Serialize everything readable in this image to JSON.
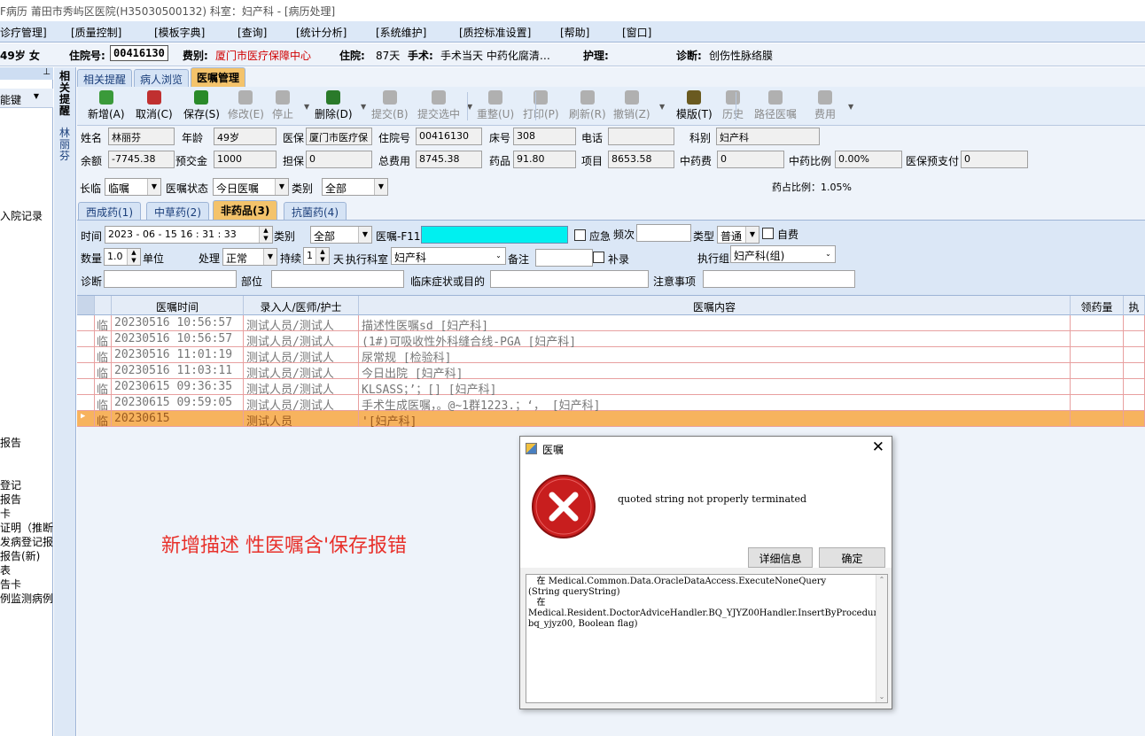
{
  "window": {
    "title": "F病历  莆田市秀屿区医院(H35030500132)  科室：妇产科 - [病历处理]"
  },
  "menu": [
    "诊疗管理]",
    "[质量控制]",
    "[模板字典]",
    "[查询]",
    "[统计分析]",
    "[系统维护]",
    "[质控标准设置]",
    "[帮助]",
    "[窗口]"
  ],
  "patient_bar": {
    "age_sex": "49岁 女",
    "inpatient_no_label": "住院号:",
    "inpatient_no": "00416130",
    "fee_type_label": "费别:",
    "fee_type": "厦门市医疗保障中心",
    "stay_label": "住院:",
    "stay": "87天",
    "surgery_label": "手术:",
    "surgery": "手术当天  中药化腐清…",
    "nursing_label": "护理:",
    "nursing": "",
    "diagnosis_label": "诊断:",
    "diagnosis": "创伤性脉络膜"
  },
  "left_panel": {
    "func_key": "能键",
    "links": [
      "入院记录",
      "报告",
      "登记",
      "报告",
      "卡",
      "证明（推断",
      "发病登记报",
      "报告(新)",
      "表",
      "告卡",
      "例监测病例"
    ]
  },
  "vertical_tabs": {
    "related": "相关提醒",
    "patient": "林丽芬"
  },
  "top_tabs": {
    "items": [
      "相关提醒",
      "病人浏览",
      "医嘱管理"
    ],
    "active": 2
  },
  "toolbar": [
    {
      "label": "新增(A)",
      "icon": "add-icon",
      "color": "#3a9a3a",
      "enabled": true
    },
    {
      "label": "取消(C)",
      "icon": "undo-icon",
      "color": "#c03030",
      "enabled": true
    },
    {
      "label": "保存(S)",
      "icon": "save-icon",
      "color": "#2a8a2a",
      "enabled": true
    },
    {
      "label": "修改(E)",
      "icon": "edit-icon",
      "color": "#b0b0b0",
      "enabled": false
    },
    {
      "label": "停止",
      "icon": "stop-icon",
      "color": "#b0b0b0",
      "enabled": false
    },
    {
      "label": "删除(D)",
      "icon": "delete-icon",
      "color": "#2a7a2a",
      "enabled": true
    },
    {
      "label": "提交(B)",
      "icon": "submit-icon",
      "color": "#b0b0b0",
      "enabled": false
    },
    {
      "label": "提交选中",
      "icon": "submit-selected-icon",
      "color": "#b0b0b0",
      "enabled": false
    },
    {
      "label": "重整(U)",
      "icon": "rearrange-icon",
      "color": "#b0b0b0",
      "enabled": false
    },
    {
      "label": "打印(P)",
      "icon": "print-icon",
      "color": "#b0b0b0",
      "enabled": false
    },
    {
      "label": "刷新(R)",
      "icon": "refresh-icon",
      "color": "#b0b0b0",
      "enabled": false
    },
    {
      "label": "撤销(Z)",
      "icon": "revoke-icon",
      "color": "#b0b0b0",
      "enabled": false
    },
    {
      "label": "模版(T)",
      "icon": "template-icon",
      "color": "#6a5a20",
      "enabled": true
    },
    {
      "label": "历史",
      "icon": "history-icon",
      "color": "#b0b0b0",
      "enabled": false
    },
    {
      "label": "路径医嘱",
      "icon": "pathway-icon",
      "color": "#b0b0b0",
      "enabled": false
    },
    {
      "label": "费用",
      "icon": "fee-icon",
      "color": "#b0b0b0",
      "enabled": false
    }
  ],
  "patient_info": {
    "name_label": "姓名",
    "name": "林丽芬",
    "age_label": "年龄",
    "age": "49岁",
    "insurance_label": "医保",
    "insurance": "厦门市医疗保",
    "inpatient_label": "住院号",
    "inpatient": "00416130",
    "bed_label": "床号",
    "bed": "308",
    "phone_label": "电话",
    "phone": "",
    "dept_label": "科别",
    "dept": "妇产科",
    "balance_label": "余额",
    "balance": "-7745.38",
    "deposit_label": "预交金",
    "deposit": "1000",
    "guarantee_label": "担保",
    "guarantee": "0",
    "total_label": "总费用",
    "total": "8745.38",
    "drug_label": "药品",
    "drug": "91.80",
    "item_label": "项目",
    "item": "8653.58",
    "tcm_label": "中药费",
    "tcm": "0",
    "tcm_ratio_label": "中药比例",
    "tcm_ratio": "0.00%",
    "prepay_label": "医保预支付",
    "prepay": "0"
  },
  "order_filter": {
    "longterm_label": "长临",
    "longterm": "临嘱",
    "status_label": "医嘱状态",
    "status": "今日医嘱",
    "category_label": "类别",
    "category": "全部",
    "drug_ratio": "药占比例：1.05%"
  },
  "order_tabs": {
    "items": [
      "西成药(1)",
      "中草药(2)",
      "非药品(3)",
      "抗菌药(4)"
    ],
    "active": 2
  },
  "order_form": {
    "time_label": "时间",
    "time": "2023 - 06 - 15   16 : 31 : 33",
    "category_label": "类别",
    "category": "全部",
    "order_label": "医嘱-F11",
    "order": "",
    "emergency_label": "应急",
    "freq_label": "频次",
    "freq": "",
    "type_label": "类型",
    "type": "普通",
    "selfpay_label": "自费",
    "qty_label": "数量",
    "qty": "1.0",
    "unit_label": "单位",
    "handle_label": "处理",
    "handle": "正常",
    "duration_label": "持续",
    "duration": "1",
    "day_label": "天",
    "exec_dept_label": "执行科室",
    "exec_dept": "妇产科",
    "remark_label": "备注",
    "remark": "",
    "supplement_label": "补录",
    "exec_group_label": "执行组",
    "exec_group": "妇产科(组)",
    "diag_label": "诊断",
    "part_label": "部位",
    "symptom_label": "临床症状或目的",
    "notes_label": "注意事项"
  },
  "grid": {
    "headers": [
      "医嘱时间",
      "录入人/医师/护士",
      "医嘱内容",
      "领药量",
      "执"
    ],
    "rows": [
      {
        "type": "临",
        "time": "20230516 10:56:57",
        "entered_by": "测试人员/测试人",
        "content": "描述性医嘱sd   [妇产科]"
      },
      {
        "type": "临",
        "time": "20230516 10:56:57",
        "entered_by": "测试人员/测试人",
        "content": "(1#)可吸收性外科缝合线-PGA   [妇产科]"
      },
      {
        "type": "临",
        "time": "20230516 11:01:19",
        "entered_by": "测试人员/测试人",
        "content": "尿常规   [检验科]"
      },
      {
        "type": "临",
        "time": "20230516 11:03:11",
        "entered_by": "测试人员/测试人",
        "content": "今日出院   [妇产科]"
      },
      {
        "type": "临",
        "time": "20230615 09:36:35",
        "entered_by": "测试人员/测试人",
        "content": "KLSASS；’；[]   [妇产科]"
      },
      {
        "type": "临",
        "time": "20230615 09:59:05",
        "entered_by": "测试人员/测试人",
        "content": "手术生成医嘱，。@~1群1223.；‘，   [妇产科]"
      },
      {
        "type": "临",
        "time": "20230615",
        "entered_by": "测试人员",
        "content": "'[妇产科]",
        "selected": true
      }
    ]
  },
  "annotation": "新增描述 性医嘱含'保存报错",
  "dialog": {
    "title": "医嘱",
    "message": "quoted string not properly terminated",
    "details_button": "详细信息",
    "ok_button": "确定",
    "details_text": "   在 Medical.Common.Data.OracleDataAccess.ExecuteNoneQuery\n(String queryString)\n   在\nMedical.Resident.DoctorAdviceHandler.BQ_YJYZ00Handler.InsertByProcedure(BQ_YJYZ00 bq_yjyz00, Boolean flag)"
  },
  "colors": {
    "accent_orange": "#f4c36b",
    "order_input_cyan": "#00f0f0",
    "fee_red": "#d00000",
    "annotation_red": "#e8302a",
    "error_red": "#c81e1e"
  }
}
